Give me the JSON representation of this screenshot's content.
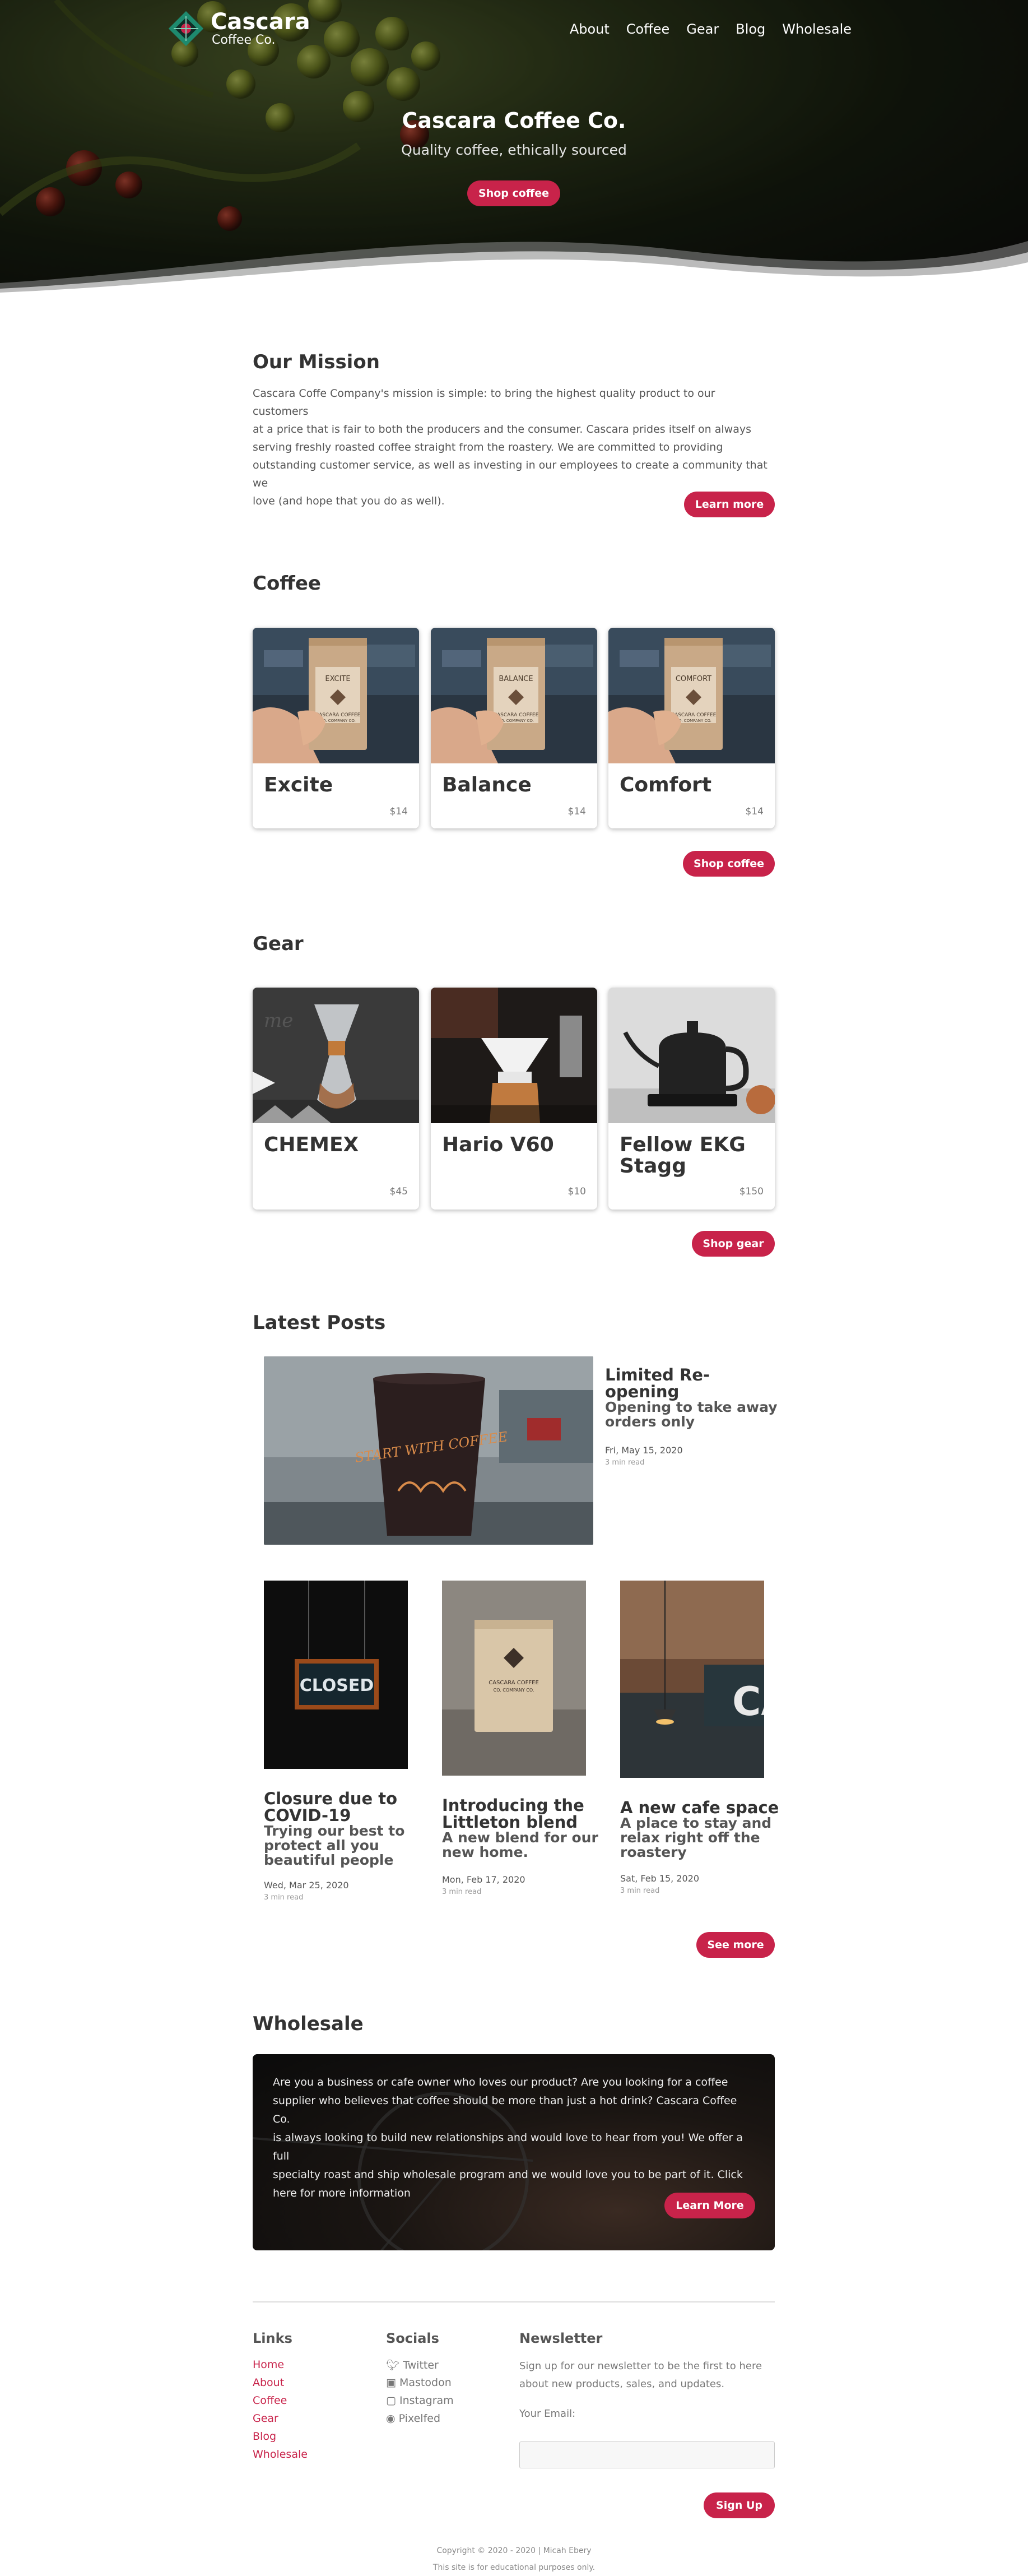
{
  "brand": {
    "line1": "Cascara",
    "line2": "Coffee Co."
  },
  "nav": [
    "About",
    "Coffee",
    "Gear",
    "Blog",
    "Wholesale"
  ],
  "hero": {
    "title": "Cascara Coffee Co.",
    "subtitle": "Quality coffee, ethically sourced",
    "button": "Shop coffee"
  },
  "mission": {
    "title": "Our Mission",
    "lines": [
      "Cascara Coffe Company's mission is simple: to bring the highest quality product to our customers",
      "at a price that is fair to both the producers and the consumer. Cascara prides itself on always",
      "serving freshly roasted coffee straight from the roastery. We are committed to providing",
      "outstanding customer service, as well as investing in our employees to create a community that we",
      "love (and hope that you do as well)."
    ],
    "button": "Learn more"
  },
  "coffee": {
    "title": "Coffee",
    "items": [
      {
        "name": "Excite",
        "price": "$14",
        "bag_label": "EXCITE"
      },
      {
        "name": "Balance",
        "price": "$14",
        "bag_label": "BALANCE"
      },
      {
        "name": "Comfort",
        "price": "$14",
        "bag_label": "COMFORT"
      }
    ],
    "bag_brand": "CASCARA COFFEE",
    "bag_brand2": "CO. COMPANY CO.",
    "button": "Shop coffee"
  },
  "gear": {
    "title": "Gear",
    "items": [
      {
        "name": "CHEMEX",
        "price": "$45"
      },
      {
        "name": "Hario V60",
        "price": "$10"
      },
      {
        "name": "Fellow EKG Stagg",
        "name_l1": "Fellow EKG",
        "name_l2": "Stagg",
        "price": "$150"
      }
    ],
    "button": "Shop gear"
  },
  "posts": {
    "title": "Latest Posts",
    "featured": {
      "title_l1": "Limited Re-",
      "title_l2": "opening",
      "sub_l1": "Opening to take away",
      "sub_l2": "orders only",
      "date": "Fri, May 15, 2020",
      "read": "3 min read",
      "cup_text": "START WITH COFFEE"
    },
    "items": [
      {
        "title_l1": "Closure due to",
        "title_l2": "COVID-19",
        "sub": [
          "Trying our best to",
          "protect all you",
          "beautiful people"
        ],
        "date": "Wed, Mar 25, 2020",
        "read": "3 min read",
        "sign": "CLOSED"
      },
      {
        "title_l1": "Introducing the",
        "title_l2": "Littleton blend",
        "sub": [
          "A new blend for our",
          "new home."
        ],
        "date": "Mon, Feb 17, 2020",
        "read": "3 min read"
      },
      {
        "title_l1": "A new cafe space",
        "title_l2": "",
        "sub": [
          "A place to stay and",
          "relax right off the",
          "roastery"
        ],
        "date": "Sat, Feb 15, 2020",
        "read": "3 min read",
        "sign": "CA"
      }
    ],
    "button": "See more"
  },
  "wholesale": {
    "title": "Wholesale",
    "lines": [
      "Are you a business or cafe owner who loves our product? Are you looking for a coffee",
      "supplier who believes that coffee should be more than just a hot drink? Cascara Coffee Co.",
      "is always looking to build new relationships and would love to hear from you! We offer a full",
      "specialty roast and ship wholesale program and we would love you to be part of it. Click",
      "here for more information"
    ],
    "button": "Learn More"
  },
  "footer": {
    "links_title": "Links",
    "links": [
      "Home",
      "About",
      "Coffee",
      "Gear",
      "Blog",
      "Wholesale"
    ],
    "socials_title": "Socials",
    "socials": [
      {
        "label": "Twitter",
        "icon": "twitter-icon"
      },
      {
        "label": "Mastodon",
        "icon": "mastodon-icon"
      },
      {
        "label": "Instagram",
        "icon": "instagram-icon"
      },
      {
        "label": "Pixelfed",
        "icon": "pixelfed-icon"
      }
    ],
    "newsletter_title": "Newsletter",
    "newsletter_l1": "Sign up for our newsletter to be the first to here",
    "newsletter_l2": "about new products, sales, and updates.",
    "email_label": "Your Email:",
    "email_value": "",
    "signup_button": "Sign Up",
    "copyright": "Copyright © 2020 - 2020 | Micah Ebery",
    "disclaimer": "This site is for educational purposes only."
  },
  "colors": {
    "accent": "#c8234a",
    "text": "#333333",
    "muted": "#777777"
  }
}
